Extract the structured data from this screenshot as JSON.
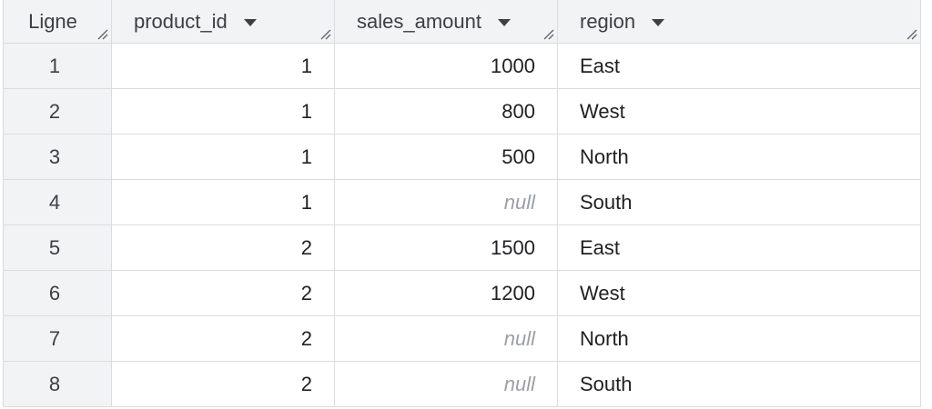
{
  "table": {
    "headers": {
      "line": "Ligne",
      "product_id": "product_id",
      "sales_amount": "sales_amount",
      "region": "region"
    },
    "rows": [
      {
        "line": "1",
        "product_id": "1",
        "sales_amount": "1000",
        "region": "East"
      },
      {
        "line": "2",
        "product_id": "1",
        "sales_amount": "800",
        "region": "West"
      },
      {
        "line": "3",
        "product_id": "1",
        "sales_amount": "500",
        "region": "North"
      },
      {
        "line": "4",
        "product_id": "1",
        "sales_amount": "null",
        "region": "South"
      },
      {
        "line": "5",
        "product_id": "2",
        "sales_amount": "1500",
        "region": "East"
      },
      {
        "line": "6",
        "product_id": "2",
        "sales_amount": "1200",
        "region": "West"
      },
      {
        "line": "7",
        "product_id": "2",
        "sales_amount": "null",
        "region": "North"
      },
      {
        "line": "8",
        "product_id": "2",
        "sales_amount": "null",
        "region": "South"
      }
    ]
  }
}
